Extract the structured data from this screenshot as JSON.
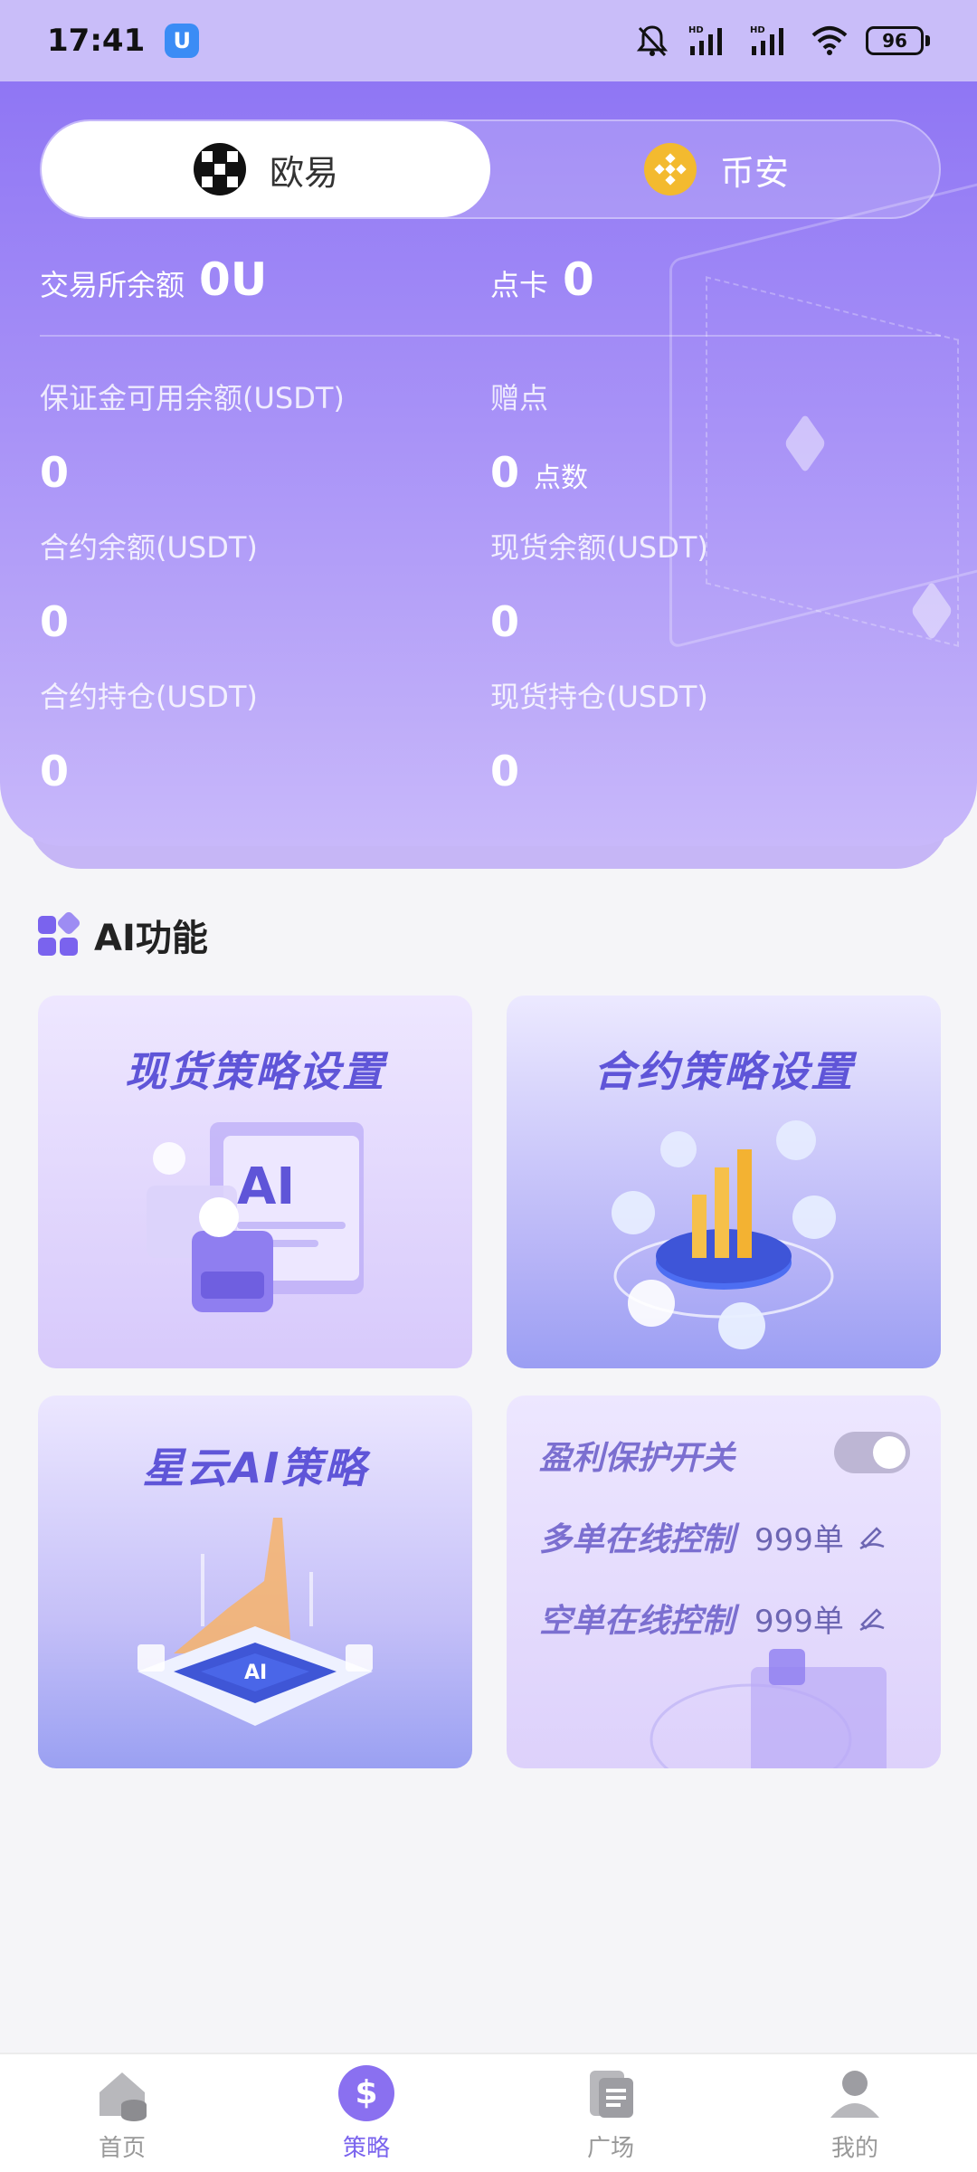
{
  "status_bar": {
    "time": "17:41",
    "battery": "96",
    "app_icon_glyph": "U",
    "icons": [
      "bell-muted-icon",
      "hd-signal-icon",
      "hd-signal-icon",
      "wifi-icon",
      "battery-icon"
    ]
  },
  "exchange_tabs": [
    {
      "label": "欧易",
      "icon": "okx-icon",
      "active": true
    },
    {
      "label": "币安",
      "icon": "binance-icon",
      "active": false
    }
  ],
  "balance": {
    "exchange_label": "交易所余额",
    "exchange_value": "0U",
    "card_label": "点卡",
    "card_value": "0"
  },
  "stats": [
    {
      "label": "保证金可用余额(USDT)",
      "value": "0",
      "unit": ""
    },
    {
      "label": "赠点",
      "value": "0",
      "unit": "点数"
    },
    {
      "label": "合约余额(USDT)",
      "value": "0",
      "unit": ""
    },
    {
      "label": "现货余额(USDT)",
      "value": "0",
      "unit": ""
    },
    {
      "label": "合约持仓(USDT)",
      "value": "0",
      "unit": ""
    },
    {
      "label": "现货持仓(USDT)",
      "value": "0",
      "unit": ""
    }
  ],
  "ai_section": {
    "title": "AI功能",
    "icon": "apps-grid-icon",
    "cards": {
      "spot": "现货策略设置",
      "contract": "合约策略设置",
      "nebula": "星云AI策略",
      "ai_badge": "AI"
    },
    "profit": {
      "title": "盈利保护开关",
      "toggle_on": false,
      "long_label": "多单在线控制",
      "long_count": "999单",
      "short_label": "空单在线控制",
      "short_count": "999单"
    }
  },
  "bottom_nav": [
    {
      "label": "首页",
      "icon": "home-icon",
      "active": false
    },
    {
      "label": "策略",
      "icon": "dollar-icon",
      "active": true
    },
    {
      "label": "广场",
      "icon": "document-icon",
      "active": false
    },
    {
      "label": "我的",
      "icon": "user-icon",
      "active": false
    }
  ],
  "colors": {
    "accent": "#7a63ee",
    "header_top": "#8f76f4",
    "header_bottom": "#c8b8fa",
    "card_title": "#5f55d8",
    "background": "#f5f5f8"
  }
}
